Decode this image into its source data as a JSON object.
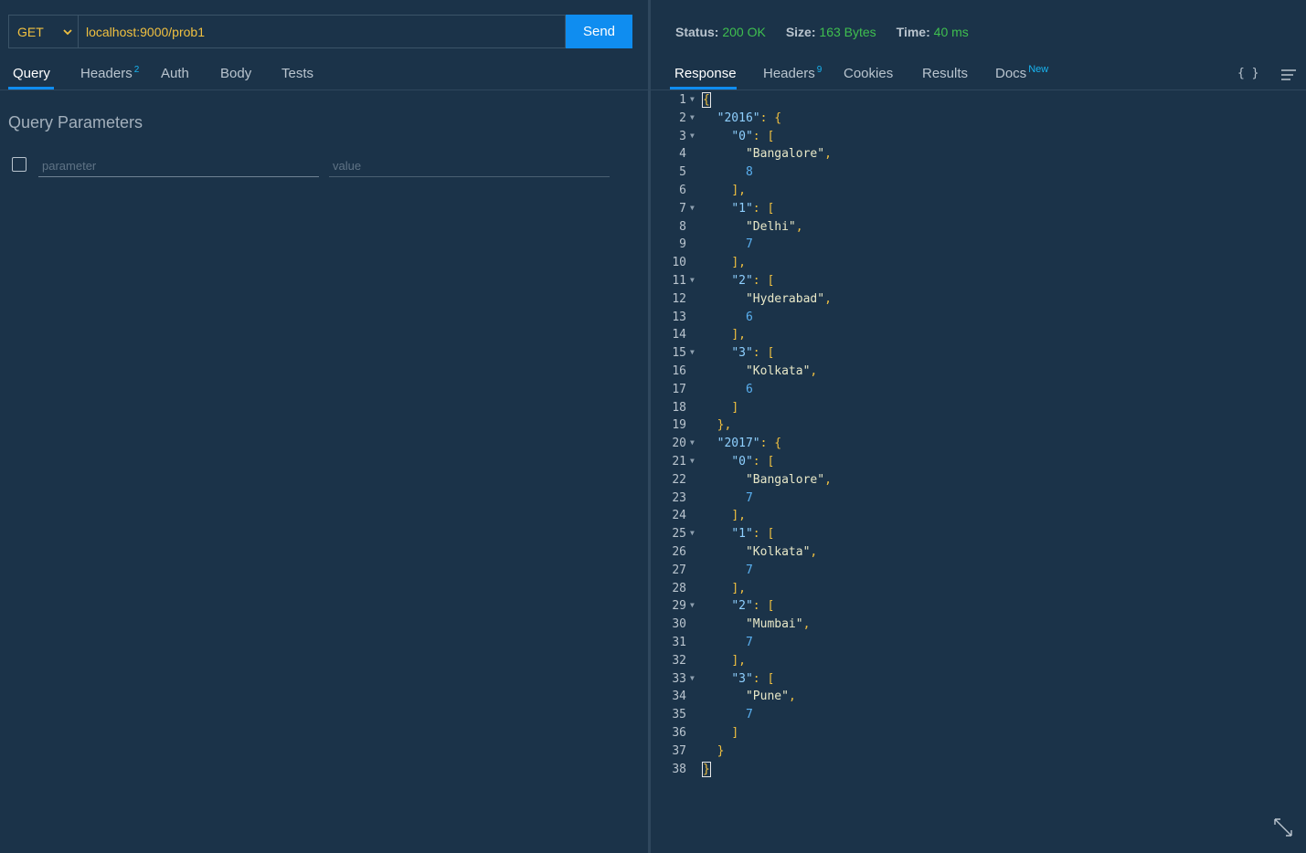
{
  "request": {
    "method": "GET",
    "url": "localhost:9000/prob1",
    "send_label": "Send"
  },
  "request_tabs": [
    {
      "label": "Query",
      "badge": ""
    },
    {
      "label": "Headers",
      "badge": "2"
    },
    {
      "label": "Auth",
      "badge": ""
    },
    {
      "label": "Body",
      "badge": ""
    },
    {
      "label": "Tests",
      "badge": ""
    }
  ],
  "query": {
    "title": "Query Parameters",
    "param_placeholder": "parameter",
    "value_placeholder": "value"
  },
  "status": {
    "status_label": "Status:",
    "status_value": "200 OK",
    "size_label": "Size:",
    "size_value": "163 Bytes",
    "time_label": "Time:",
    "time_value": "40 ms"
  },
  "response_tabs": [
    {
      "label": "Response",
      "badge": ""
    },
    {
      "label": "Headers",
      "badge": "9"
    },
    {
      "label": "Cookies",
      "badge": ""
    },
    {
      "label": "Results",
      "badge": ""
    },
    {
      "label": "Docs",
      "badge": "New"
    }
  ],
  "response_tools": {
    "format_label": "{ }"
  },
  "response_body": {
    "2016": [
      [
        "Bangalore",
        8
      ],
      [
        "Delhi",
        7
      ],
      [
        "Hyderabad",
        6
      ],
      [
        "Kolkata",
        6
      ]
    ],
    "2017": [
      [
        "Bangalore",
        7
      ],
      [
        "Kolkata",
        7
      ],
      [
        "Mumbai",
        7
      ],
      [
        "Pune",
        7
      ]
    ]
  },
  "code_lines": [
    "{",
    "  \"2016\": {",
    "    \"0\": [",
    "      \"Bangalore\",",
    "      8",
    "    ],",
    "    \"1\": [",
    "      \"Delhi\",",
    "      7",
    "    ],",
    "    \"2\": [",
    "      \"Hyderabad\",",
    "      6",
    "    ],",
    "    \"3\": [",
    "      \"Kolkata\",",
    "      6",
    "    ]",
    "  },",
    "  \"2017\": {",
    "    \"0\": [",
    "      \"Bangalore\",",
    "      7",
    "    ],",
    "    \"1\": [",
    "      \"Kolkata\",",
    "      7",
    "    ],",
    "    \"2\": [",
    "      \"Mumbai\",",
    "      7",
    "    ],",
    "    \"3\": [",
    "      \"Pune\",",
    "      7",
    "    ]",
    "  }",
    "}"
  ],
  "foldable_lines": [
    1,
    2,
    3,
    7,
    11,
    15,
    20,
    21,
    25,
    29,
    33
  ],
  "icons": {
    "method_dropdown": "chevron-down-icon",
    "format": "braces-icon",
    "wrap": "menu-icon",
    "expand": "expand-icon",
    "fold": "fold-arrow-icon"
  },
  "colors": {
    "background": "#1b3349",
    "accent": "#0f8df0",
    "status_ok": "#3fbf4f",
    "method": "#f0c040",
    "json_key": "#8fd0ff",
    "json_string": "#e8e8c8",
    "json_number": "#5ab0f0",
    "json_punct": "#f0c040"
  }
}
